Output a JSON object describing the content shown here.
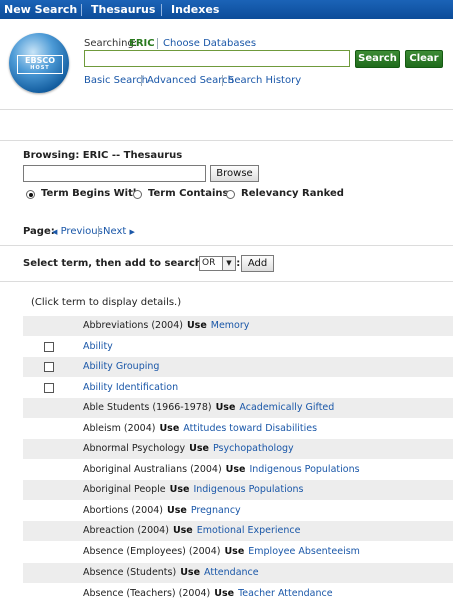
{
  "topnav": {
    "new_search": "New Search",
    "thesaurus": "Thesaurus",
    "indexes": "Indexes"
  },
  "logo": {
    "text": "EBSCO",
    "sub": "HOST"
  },
  "search": {
    "searching_label": "Searching:",
    "database": "ERIC",
    "choose_databases": "Choose Databases",
    "query": "",
    "search_button": "Search",
    "clear_button": "Clear",
    "links": {
      "basic": "Basic Search",
      "advanced": "Advanced Search",
      "history": "Search History"
    }
  },
  "browse": {
    "title": "Browsing: ERIC -- Thesaurus",
    "value": "",
    "browse_button": "Browse",
    "options": [
      {
        "label": "Term Begins With",
        "selected": true
      },
      {
        "label": "Term Contains",
        "selected": false
      },
      {
        "label": "Relevancy Ranked",
        "selected": false
      }
    ]
  },
  "pager": {
    "label": "Page:",
    "previous": "Previous",
    "next": "Next"
  },
  "add": {
    "label": "Select term, then add to search using:",
    "operator": "OR",
    "add_button": "Add"
  },
  "hint": "(Click term to display details.)",
  "use_word": "Use",
  "terms": [
    {
      "term": "Abbreviations (2004)",
      "use": "Memory",
      "checkbox": false,
      "link": false
    },
    {
      "term": "Ability",
      "use": "",
      "checkbox": true,
      "link": true
    },
    {
      "term": "Ability Grouping",
      "use": "",
      "checkbox": true,
      "link": true
    },
    {
      "term": "Ability Identification",
      "use": "",
      "checkbox": true,
      "link": true
    },
    {
      "term": "Able Students (1966-1978)",
      "use": "Academically Gifted",
      "checkbox": false,
      "link": false
    },
    {
      "term": "Ableism (2004)",
      "use": "Attitudes toward Disabilities",
      "checkbox": false,
      "link": false
    },
    {
      "term": "Abnormal Psychology",
      "use": "Psychopathology",
      "checkbox": false,
      "link": false
    },
    {
      "term": "Aboriginal Australians (2004)",
      "use": "Indigenous Populations",
      "checkbox": false,
      "link": false
    },
    {
      "term": "Aboriginal People",
      "use": "Indigenous Populations",
      "checkbox": false,
      "link": false
    },
    {
      "term": "Abortions (2004)",
      "use": "Pregnancy",
      "checkbox": false,
      "link": false
    },
    {
      "term": "Abreaction (2004)",
      "use": "Emotional Experience",
      "checkbox": false,
      "link": false
    },
    {
      "term": "Absence (Employees) (2004)",
      "use": "Employee Absenteeism",
      "checkbox": false,
      "link": false
    },
    {
      "term": "Absence (Students)",
      "use": "Attendance",
      "checkbox": false,
      "link": false
    },
    {
      "term": "Absence (Teachers) (2004)",
      "use": "Teacher Attendance",
      "checkbox": false,
      "link": false
    }
  ]
}
